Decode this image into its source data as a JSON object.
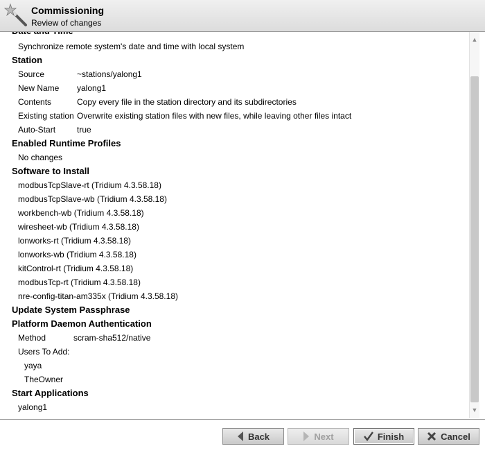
{
  "header": {
    "title": "Commissioning",
    "subtitle": "Review of changes"
  },
  "review": {
    "cut_heading": "Date and Time",
    "date_time_desc": "Synchronize remote system's date and time with local system",
    "station": {
      "heading": "Station",
      "rows": [
        {
          "key": "Source",
          "value": "~stations/yalong1"
        },
        {
          "key": "New Name",
          "value": "yalong1"
        },
        {
          "key": "Contents",
          "value": "Copy every file in the station directory and its subdirectories"
        },
        {
          "key": "Existing station",
          "value": "Overwrite existing station files with new files, while leaving other files intact"
        },
        {
          "key": "Auto-Start",
          "value": "true"
        }
      ]
    },
    "profiles": {
      "heading": "Enabled Runtime Profiles",
      "text": "No changes"
    },
    "software": {
      "heading": "Software to Install",
      "items": [
        "modbusTcpSlave-rt (Tridium 4.3.58.18)",
        "modbusTcpSlave-wb (Tridium 4.3.58.18)",
        "workbench-wb (Tridium 4.3.58.18)",
        "wiresheet-wb (Tridium 4.3.58.18)",
        "lonworks-rt (Tridium 4.3.58.18)",
        "lonworks-wb (Tridium 4.3.58.18)",
        "kitControl-rt (Tridium 4.3.58.18)",
        "modbusTcp-rt (Tridium 4.3.58.18)",
        "nre-config-titan-am335x (Tridium 4.3.58.18)"
      ]
    },
    "passphrase": {
      "heading": "Update System Passphrase"
    },
    "daemon": {
      "heading": "Platform Daemon Authentication",
      "method_key": "Method",
      "method_value": "scram-sha512/native",
      "users_key": "Users To Add:",
      "users": [
        "yaya",
        "TheOwner"
      ]
    },
    "apps": {
      "heading": "Start Applications",
      "items": [
        "yalong1"
      ]
    }
  },
  "buttons": {
    "back": "Back",
    "next": "Next",
    "finish": "Finish",
    "cancel": "Cancel"
  },
  "colors": {
    "header_bg": "#e6e6e6",
    "button_bg": "#d6d6d6",
    "cancel_icon": "#444444",
    "finish_icon": "#444444"
  }
}
